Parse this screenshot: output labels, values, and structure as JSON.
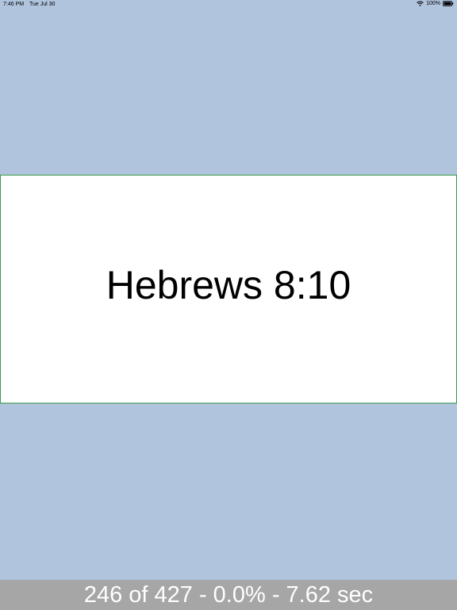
{
  "status_bar": {
    "time": "7:46 PM",
    "date": "Tue Jul 30",
    "battery": "100%"
  },
  "card": {
    "reference": "Hebrews 8:10"
  },
  "footer": {
    "progress_text": "246 of 427 - 0.0% - 7.62 sec"
  },
  "colors": {
    "background": "#b0c4de",
    "card": "#ffffff",
    "card_border": "#3a9a4a",
    "footer": "#a6a6a6",
    "footer_text": "#ffffff"
  },
  "icons": [
    "wifi-icon",
    "battery-icon"
  ]
}
